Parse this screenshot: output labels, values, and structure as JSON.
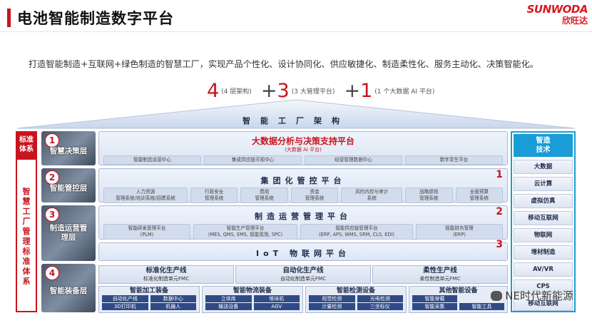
{
  "header": {
    "title": "电池智能制造数字平台",
    "brand_en": "SUNWODA",
    "brand_cn": "欣旺达"
  },
  "subtitle": "打造智能制造+互联网+绿色制造的智慧工厂，实现产品个性化、设计协同化、供应敏捷化、制造柔性化、服务主动化、决策智能化。",
  "formula": {
    "n1": "4",
    "n1_note": "(4 层架构)",
    "plus1": "+",
    "n2": "3",
    "n2_note": "(3 大管理平台)",
    "plus2": "+",
    "n3": "1",
    "n3_note": "(1 个大数据 AI 平台)"
  },
  "roof_title": "智能工厂架构",
  "left_column": {
    "top": [
      "标准",
      "体系"
    ],
    "vertical": "智慧工厂管理标准体系"
  },
  "layers": [
    {
      "num": "1",
      "name": "智慧决策层"
    },
    {
      "num": "2",
      "name": "智能管控层"
    },
    {
      "num": "3",
      "name": "制造运营管理层"
    },
    {
      "num": "4",
      "name": "智能装备层"
    }
  ],
  "bigdata": {
    "title": "大数据分析与决策支持平台",
    "sub": "(大数据 AI 平台)",
    "chips": [
      "智能制造运营中心",
      "集成供应链可视中心",
      "经营管理数据中心",
      "数字孪生平台"
    ]
  },
  "group_platform": {
    "title": "集团化管控平台",
    "num": "1",
    "chips": [
      "人力资源\n管理系统/培训系统/招聘系统",
      "行政安全\n管理系统",
      "费用\n管理系统",
      "资金\n管理系统",
      "风险内控与审计\n系统",
      "战略绩效\n管理系统",
      "全面预算\n管理系统"
    ]
  },
  "mfg_platform": {
    "title": "制造运营管理平台",
    "num": "2",
    "chips": [
      "智能研发管理平台\n(PLM)",
      "智能生产管理平台\n(MES, QMS, EMS, 智能现场, SPC)",
      "智能供应链管理平台\n(ERP, APS, WMS, SRM, CLS, EDI)",
      "智能财务管理\n(ERP)"
    ]
  },
  "iot_platform": {
    "title": "IoT 物联网平台",
    "num": "3"
  },
  "lines": [
    {
      "title": "标准化生产线",
      "sub": "标准化制造单元FMC"
    },
    {
      "title": "自动化生产线",
      "sub": "自动化制造单元FMC"
    },
    {
      "title": "柔性生产线",
      "sub": "柔性制造单元FMC"
    }
  ],
  "equipment": [
    {
      "title": "智能加工装备",
      "items": [
        "自动化产线",
        "数据中心",
        "3D打印机",
        "机器人"
      ]
    },
    {
      "title": "智能物流装备",
      "items": [
        "立体库",
        "堆垛机",
        "输送设备",
        "AGV"
      ]
    },
    {
      "title": "智能检测设备",
      "items": [
        "视觉检测",
        "光电检测",
        "计量检测",
        "三坐标仪"
      ]
    },
    {
      "title": "其他智能设备",
      "items": [
        "智能穿戴",
        "",
        "智能采集",
        "智能工具"
      ]
    }
  ],
  "right_column": {
    "head": [
      "智造",
      "技术"
    ],
    "items": [
      "大数据",
      "云计算",
      "虚拟仿真",
      "移动互联网",
      "物联网",
      "增材制造",
      "AV/VR",
      "CPS",
      "移动互联网"
    ]
  },
  "watermark": "NE时代新能源",
  "colors": {
    "accent_red": "#c8151d",
    "accent_blue": "#1a9cd6",
    "navy": "#1d2a4a"
  }
}
